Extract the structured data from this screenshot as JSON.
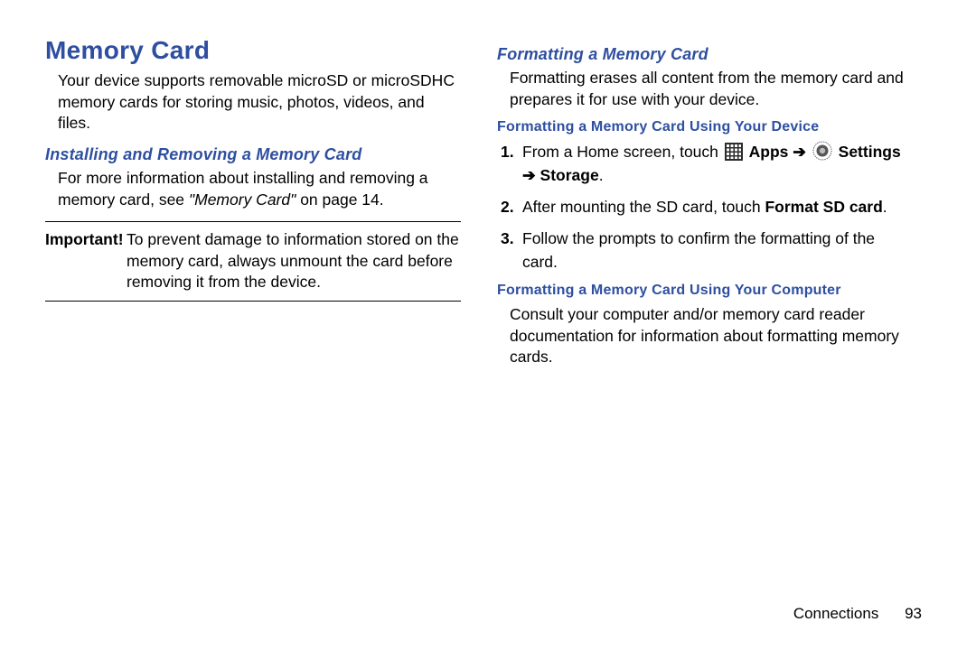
{
  "left": {
    "title": "Memory Card",
    "intro": "Your device supports removable microSD or microSDHC memory cards for storing music, photos, videos, and files.",
    "sub1": "Installing and Removing a Memory Card",
    "sub1_text_a": "For more information about installing and removing a memory card, see ",
    "sub1_ref": "\"Memory Card\"",
    "sub1_text_b": " on page 14.",
    "important_label": "Important!",
    "important_text": "To prevent damage to information stored on the memory card, always unmount the card before removing it from the device."
  },
  "right": {
    "sub1": "Formatting a Memory Card",
    "intro": "Formatting erases all content from the memory card and prepares it for use with your device.",
    "using_device_title": "Formatting a Memory Card Using Your Device",
    "step1_a": "From a Home screen, touch ",
    "step1_apps": "Apps",
    "step1_arrow1": " ➔ ",
    "step1_settings": "Settings",
    "step1_arrow2": "➔ ",
    "step1_storage": "Storage",
    "step1_period": ".",
    "step2_a": "After mounting the SD card, touch ",
    "step2_b": "Format SD card",
    "step2_c": ".",
    "step3": "Follow the prompts to confirm the formatting of the card.",
    "using_computer_title": "Formatting a Memory Card Using Your Computer",
    "using_computer_text": "Consult your computer and/or memory card reader documentation for information about formatting memory cards."
  },
  "footer": {
    "chapter": "Connections",
    "page": "93"
  }
}
